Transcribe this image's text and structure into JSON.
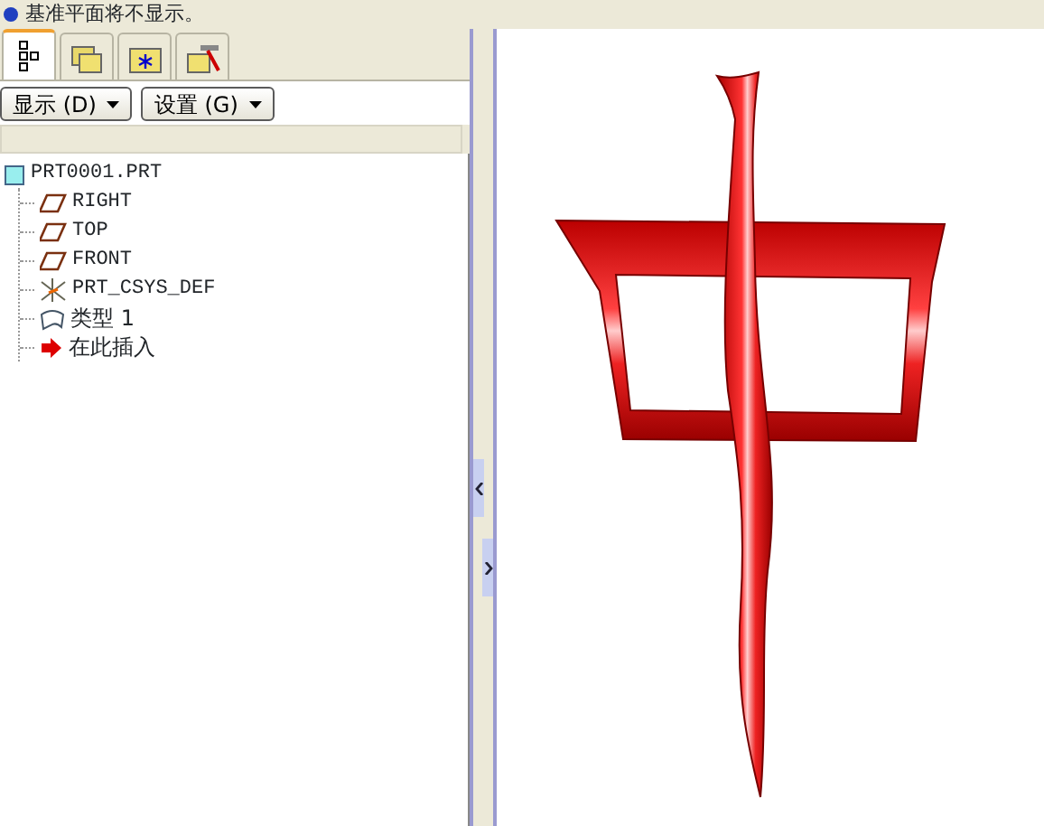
{
  "message": {
    "text": "基准平面将不显示。"
  },
  "tabs": [
    {
      "kind": "tree",
      "selected": true
    },
    {
      "kind": "folders",
      "selected": false
    },
    {
      "kind": "favorites",
      "selected": false
    },
    {
      "kind": "tools",
      "selected": false
    }
  ],
  "toolbar": {
    "buttons": [
      "显示 (D)",
      "设置 (G)"
    ]
  },
  "tree": {
    "items": [
      {
        "kind": "part",
        "label": "PRT0001.PRT",
        "children": [
          {
            "kind": "plane",
            "label": "RIGHT"
          },
          {
            "kind": "plane",
            "label": "TOP"
          },
          {
            "kind": "plane",
            "label": "FRONT"
          },
          {
            "kind": "csys",
            "label": "PRT_CSYS_DEF"
          },
          {
            "kind": "feature",
            "label": "类型 1"
          },
          {
            "kind": "insert",
            "label": "在此插入"
          }
        ]
      }
    ]
  }
}
